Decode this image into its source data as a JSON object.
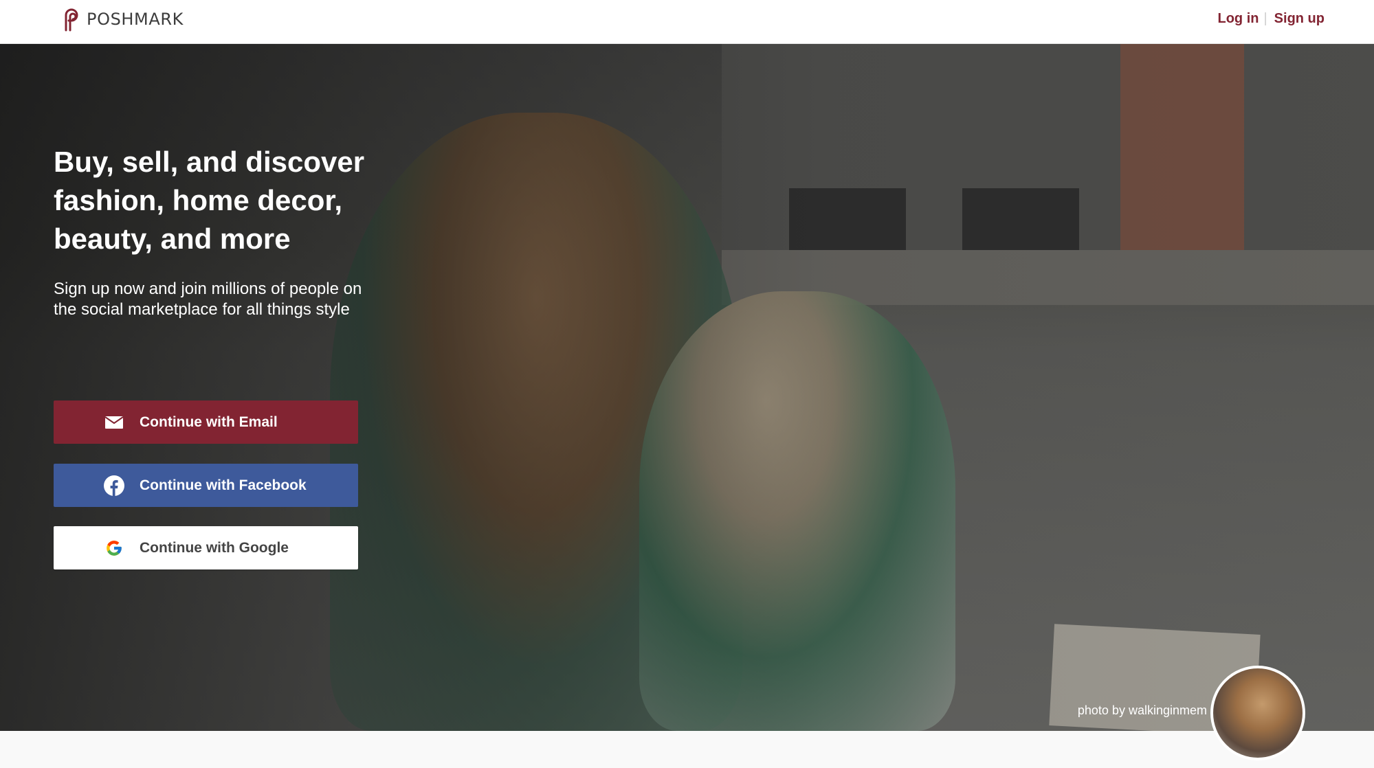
{
  "header": {
    "brand": "POSHMARK",
    "login_label": "Log in",
    "separator": "|",
    "signup_label": "Sign up"
  },
  "hero": {
    "headline": "Buy, sell, and discover fashion, home decor, beauty, and more",
    "subline": "Sign up now and join millions of people on the social marketplace for all things style",
    "buttons": {
      "email": "Continue with Email",
      "facebook": "Continue with Facebook",
      "google": "Continue with Google"
    },
    "photo_credit": "photo by walkinginmem"
  },
  "colors": {
    "brand": "#822432",
    "facebook": "#3e5a9b"
  },
  "icons": [
    "poshmark-logo-icon",
    "email-icon",
    "facebook-icon",
    "google-icon"
  ]
}
